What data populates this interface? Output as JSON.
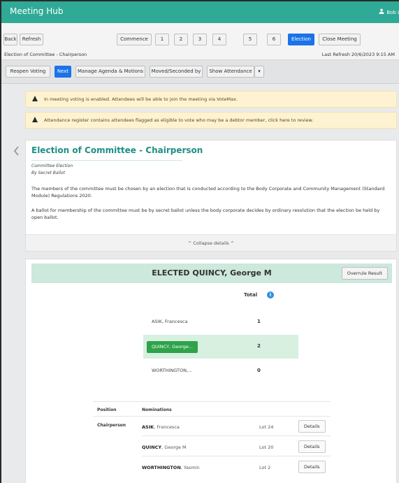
{
  "app": {
    "title": "Meeting Hub",
    "user": "Bob L"
  },
  "toolbar": {
    "back": "Back",
    "refresh": "Refresh",
    "commence": "Commence",
    "steps": [
      "1",
      "2",
      "3",
      "4",
      "5",
      "6"
    ],
    "election": "Election",
    "close_meeting": "Close Meeting",
    "breadcrumb": "Election of Committee - Chairperson",
    "last_refresh": "Last Refresh 20/6/2023 9:15 AM"
  },
  "actions": {
    "reopen_voting": "Reopen Voting",
    "next": "Next",
    "manage_agenda": "Manage Agenda & Motions",
    "moved_seconded": "Moved/Seconded by",
    "show_attendance": "Show Attendance",
    "more": "▾"
  },
  "alerts": [
    "In meeting voting is enabled. Attendees will be able to join the meeting via VoteMax.",
    "Attendance register contains attendees flagged as eligible to vote who may be a debtor member, click here to review."
  ],
  "motion": {
    "title": "Election of Committee - Chairperson",
    "type": "Committee Election",
    "method": "By Secret Ballot",
    "para1": "The members of the committee must be chosen by an election that is conducted according to the Body Corporate and Community Management (Standard Module) Regulations 2020.",
    "para2": "A ballot for membership of the committee must be by secret ballot unless the body corporate decides by ordinary resolution that the election be held by open ballot.",
    "collapse": "^ Collapse details ^"
  },
  "result": {
    "banner": "ELECTED QUINCY, George M",
    "overrule": "Overrule Result",
    "total_header": "Total",
    "info_icon": "i",
    "accent": "#2ea34a",
    "candidates": [
      {
        "name": "ASIK, Francesca",
        "total": "1",
        "elected": false
      },
      {
        "name": "QUINCY, George...",
        "total": "2",
        "elected": true
      },
      {
        "name": "WORTHINGTON,...",
        "total": "0",
        "elected": false
      }
    ]
  },
  "nominations": {
    "position_header": "Position",
    "nominations_header": "Nominations",
    "position": "Chairperson",
    "rows": [
      {
        "surname": "ASIK",
        "given": "Francesca",
        "lot": "Lot 24",
        "details": "Details"
      },
      {
        "surname": "QUINCY",
        "given": "George M",
        "lot": "Lot 20",
        "details": "Details"
      },
      {
        "surname": "WORTHINGTON",
        "given": "Yasmin",
        "lot": "Lot 2",
        "details": "Details"
      }
    ]
  }
}
